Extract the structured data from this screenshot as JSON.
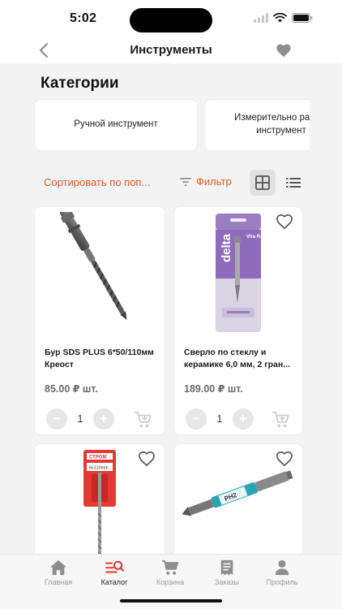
{
  "status": {
    "time": "5:02"
  },
  "nav": {
    "title": "Инструменты"
  },
  "categories": {
    "heading": "Категории",
    "items": [
      {
        "label": "Ручной инструмент"
      },
      {
        "label": "Измерительно разм... инструмент"
      }
    ]
  },
  "toolbar": {
    "sort_label": "Сортировать по поп...",
    "filter_label": "Фильтр"
  },
  "products": [
    {
      "name": "Бур SDS PLUS 6*50/110мм Креост",
      "price": "85.00 ₽ шт.",
      "qty": "1"
    },
    {
      "name": "Сверло по стеклу и керамике 6,0 мм, 2 гран...",
      "price": "189.00 ₽ шт.",
      "qty": "1"
    },
    {
      "name": "",
      "price": "",
      "qty": ""
    },
    {
      "name": "",
      "price": "",
      "qty": ""
    }
  ],
  "product_image_text": {
    "drill_bit_package_brand": "Vira Rage",
    "drill_bit_package_series": "delta",
    "sds_package_brand": "СТРОМ",
    "sds_package_size": "6x110mm",
    "bit_marking": "PH2"
  },
  "tabbar": {
    "items": [
      {
        "label": "Главная"
      },
      {
        "label": "Каталог"
      },
      {
        "label": "Корзина"
      },
      {
        "label": "Заказы"
      },
      {
        "label": "Профиль"
      }
    ]
  },
  "colors": {
    "accent": "#e8592b",
    "active_tab": "#e53935",
    "icon_gray": "#8e8e8e"
  }
}
